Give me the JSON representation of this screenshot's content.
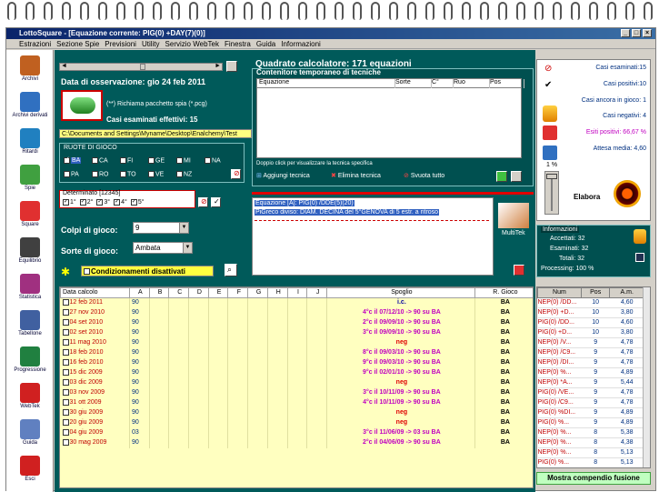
{
  "window": {
    "title": "LottoSquare - [Equazione corrente: PIG(0) +DAY(7)(0)]"
  },
  "menu": [
    "Estrazioni",
    "Sezione Spie",
    "Previsioni",
    "Utility",
    "Servizio WebTek",
    "Finestra",
    "Guida",
    "Informazioni"
  ],
  "sidebar": [
    {
      "label": "Archivi",
      "color": "#c06020"
    },
    {
      "label": "Archivi derivati",
      "color": "#3070c0"
    },
    {
      "label": "Ritardi",
      "color": "#2080c0"
    },
    {
      "label": "Spie",
      "color": "#40a040"
    },
    {
      "label": "Square",
      "color": "#e03030"
    },
    {
      "label": "Equilibrio",
      "color": "#404040"
    },
    {
      "label": "Statistica",
      "color": "#a03080"
    },
    {
      "label": "Tabellone",
      "color": "#4060a0"
    },
    {
      "label": "Progressione",
      "color": "#208040"
    },
    {
      "label": "WebTek",
      "color": "#d02020"
    },
    {
      "label": "Guida",
      "color": "#6080c0"
    },
    {
      "label": "Esci",
      "color": "#d02020"
    }
  ],
  "observation": {
    "date_label": "Data di osservazione:",
    "date_value": "gio 24 feb 2011",
    "spy_hint": "(**) Richiama pacchetto spia (*.pcg)",
    "cases_label": "Casi esaminati effettivi: 15",
    "path": "C:\\Documents and Settings\\Myname\\Desktop\\Enalchemy\\Test"
  },
  "wheels": {
    "title": "RUOTE DI GIOCO",
    "row1": [
      "BA",
      "CA",
      "FI",
      "GE",
      "MI",
      "NA"
    ],
    "row2": [
      "PA",
      "RO",
      "TO",
      "VE",
      "NZ"
    ]
  },
  "determinato": {
    "title": "Determinato [12345]",
    "items": [
      "1°",
      "2°",
      "3°",
      "4°",
      "5°"
    ]
  },
  "colpi": {
    "label": "Colpi di gioco:",
    "value": "9"
  },
  "sorte": {
    "label": "Sorte di gioco:",
    "value": "Ambata"
  },
  "condizionamenti": "Condizionamenti disattivati",
  "calc": {
    "title": "Quadrato calcolatore: 171 equazioni",
    "container_title": "Contenitore temporaneo di tecniche",
    "cols": [
      "Equazione",
      "Sorte",
      "C°",
      "Ruo",
      "Pos"
    ],
    "hint": "Doppio click per visualizzare la tecnica specifica",
    "add": "Aggiungi tecnica",
    "remove": "Elimina tecnica",
    "empty": "Svuota tutto"
  },
  "equation": {
    "line1": "Equazione [A]: PIG(0) /DDE(5)(20)",
    "line2": "PiGreco diviso: DIAM. DECINA del 5°GENOVA  di 5 estr. a ritroso",
    "multitek": "MultiTek"
  },
  "stats": {
    "esaminati": "Casi esaminati:15",
    "positivi": "Casi positivi:10",
    "ancora": "Casi ancora in gioco: 1",
    "negativi": "Casi negativi: 4",
    "esiti": "Esiti positivi: 66,67 %",
    "attesa": "Attesa media: 4,60",
    "percent": "1 %",
    "elabora": "Elabora"
  },
  "info": {
    "title": "Informazioni",
    "accettati": "Accettati:  32",
    "esaminati": "Esaminati:  32",
    "totali": "Totali:  32",
    "processing": "Processing:  100 %"
  },
  "grid": {
    "headers": [
      "Data calcolo",
      "A",
      "B",
      "C",
      "D",
      "E",
      "F",
      "G",
      "H",
      "I",
      "J",
      "Spoglio",
      "R. Gioco"
    ],
    "rows": [
      [
        "12 feb 2011",
        "90",
        "i.c.",
        "BA",
        "#0000a0"
      ],
      [
        "27 nov 2010",
        "90",
        "4°c il 07/12/10 -> 90 su BA",
        "BA",
        "#c000c0"
      ],
      [
        "04 set 2010",
        "90",
        "2°c il 09/09/10 -> 90 su BA",
        "BA",
        "#c000c0"
      ],
      [
        "02 set 2010",
        "90",
        "3°c il 09/09/10 -> 90 su BA",
        "BA",
        "#c000c0"
      ],
      [
        "11 mag 2010",
        "90",
        "neg",
        "BA",
        "#e00000"
      ],
      [
        "18 feb 2010",
        "90",
        "8°c il 09/03/10 -> 90 su BA",
        "BA",
        "#c000c0"
      ],
      [
        "16 feb 2010",
        "90",
        "9°c il 09/03/10 -> 90 su BA",
        "BA",
        "#c000c0"
      ],
      [
        "15 dic 2009",
        "90",
        "9°c il 02/01/10 -> 90 su BA",
        "BA",
        "#c000c0"
      ],
      [
        "03 dic 2009",
        "90",
        "neg",
        "BA",
        "#e00000"
      ],
      [
        "03 nov 2009",
        "90",
        "3°c il 10/11/09 -> 90 su BA",
        "BA",
        "#c000c0"
      ],
      [
        "31 ott 2009",
        "90",
        "4°c il 10/11/09 -> 90 su BA",
        "BA",
        "#c000c0"
      ],
      [
        "30 giu 2009",
        "90",
        "neg",
        "BA",
        "#e00000"
      ],
      [
        "20 giu 2009",
        "90",
        "neg",
        "BA",
        "#e00000"
      ],
      [
        "04 giu 2009",
        "03",
        "3°c il 11/06/09 -> 03 su BA",
        "BA",
        "#c000c0"
      ],
      [
        "30 mag 2009",
        "90",
        "2°c il 04/06/09 -> 90 su BA",
        "BA",
        "#c000c0"
      ]
    ]
  },
  "ranking": {
    "headers": [
      "Num",
      "Pos",
      "A.m."
    ],
    "rows": [
      [
        "NEP(0) /DD...",
        "10",
        "4,60"
      ],
      [
        "NEP(0) +D...",
        "10",
        "3,80"
      ],
      [
        "PIG(0) /DD...",
        "10",
        "4,60"
      ],
      [
        "PIG(0) +D...",
        "10",
        "3,80"
      ],
      [
        "NEP(0) /V...",
        "9",
        "4,78"
      ],
      [
        "NEP(0) /C9...",
        "9",
        "4,78"
      ],
      [
        "NEP(0) /DI...",
        "9",
        "4,78"
      ],
      [
        "NEP(0) %...",
        "9",
        "4,89"
      ],
      [
        "NEP(0) *A...",
        "9",
        "5,44"
      ],
      [
        "PIG(0) /VE...",
        "9",
        "4,78"
      ],
      [
        "PIG(0) /C9...",
        "9",
        "4,78"
      ],
      [
        "PIG(0) %DI...",
        "9",
        "4,89"
      ],
      [
        "PIG(0) %...",
        "9",
        "4,89"
      ],
      [
        "NEP(0) %...",
        "8",
        "5,38"
      ],
      [
        "NEP(0) %...",
        "8",
        "4,38"
      ],
      [
        "NEP(0) %...",
        "8",
        "5,13"
      ],
      [
        "PIG(0) %...",
        "8",
        "5,13"
      ],
      [
        "PIG(0) %RI...",
        "8",
        "5,38"
      ],
      [
        "PIG(0) %...",
        "8",
        "4,38"
      ]
    ],
    "footer": "Mostra compendio fusione"
  }
}
